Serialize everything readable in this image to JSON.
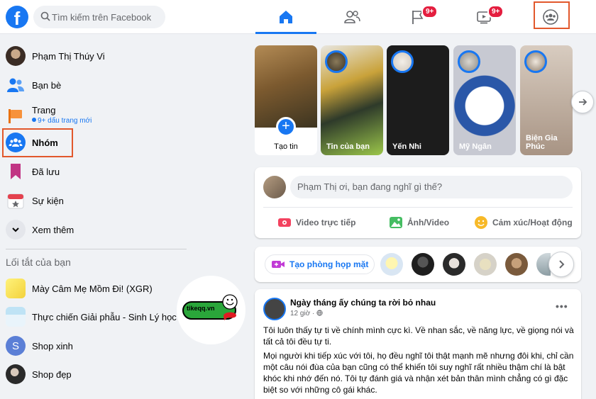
{
  "header": {
    "logo_letter": "f",
    "search_placeholder": "Tìm kiếm trên Facebook",
    "badges": {
      "groups_tab": "9+",
      "watch_tab": "9+"
    }
  },
  "sidebar": {
    "profile_name": "Phạm Thị Thúy Vi",
    "items": [
      {
        "label": "Bạn bè"
      },
      {
        "label": "Trang",
        "sub": "9+ dấu trang mới"
      },
      {
        "label": "Nhóm"
      },
      {
        "label": "Đã lưu"
      },
      {
        "label": "Sự kiện"
      },
      {
        "label": "Xem thêm"
      }
    ],
    "shortcuts_heading": "Lối tắt của bạn",
    "shortcuts": [
      {
        "label": "Mày Câm Mẹ Mồm Đi! (XGR)"
      },
      {
        "label": "Thực chiến Giải phẫu - Sinh Lý học"
      },
      {
        "label": "Shop xinh",
        "initial": "S"
      },
      {
        "label": "Shop đẹp"
      }
    ]
  },
  "watermark": {
    "text": "tikeqq.vn"
  },
  "stories": [
    {
      "name": "Tạo tin",
      "plus": "+"
    },
    {
      "name": "Tin của bạn"
    },
    {
      "name": "Yến Nhi"
    },
    {
      "name": "Mỹ Ngân"
    },
    {
      "name": "Biện Gia Phúc"
    }
  ],
  "composer": {
    "placeholder": "Phạm Thị ơi, bạn đang nghĩ gì thế?",
    "actions": [
      "Video trực tiếp",
      "Ảnh/Video",
      "Cảm xúc/Hoạt động"
    ]
  },
  "rooms": {
    "create_label": "Tạo phòng họp mặt"
  },
  "post": {
    "author": "Ngày tháng ấy chúng ta rời bỏ nhau",
    "time": "12 giờ ·",
    "more": "•••",
    "paragraphs": [
      "Tôi luôn thấy tự ti về chính mình cực kì. Về nhan sắc, về năng lực, về giọng nói và tất cả tôi đều tự ti.",
      "Mọi người khi tiếp xúc với tôi, họ đều nghĩ tôi thật mạnh mẽ nhưng đôi khi, chỉ cần một câu nói đùa của bạn cũng có thể khiến tôi suy nghĩ rất nhiều thậm chí là bật khóc khi nhớ đến nó. Tôi tự đánh giá và nhận xét bản thân mình chẳng có gì đặc biệt so với những cô gái khác."
    ]
  },
  "colors": {
    "brand": "#1877f2",
    "highlight": "#e2582c",
    "badge": "#e41e3f",
    "background": "#f0f2f5"
  }
}
